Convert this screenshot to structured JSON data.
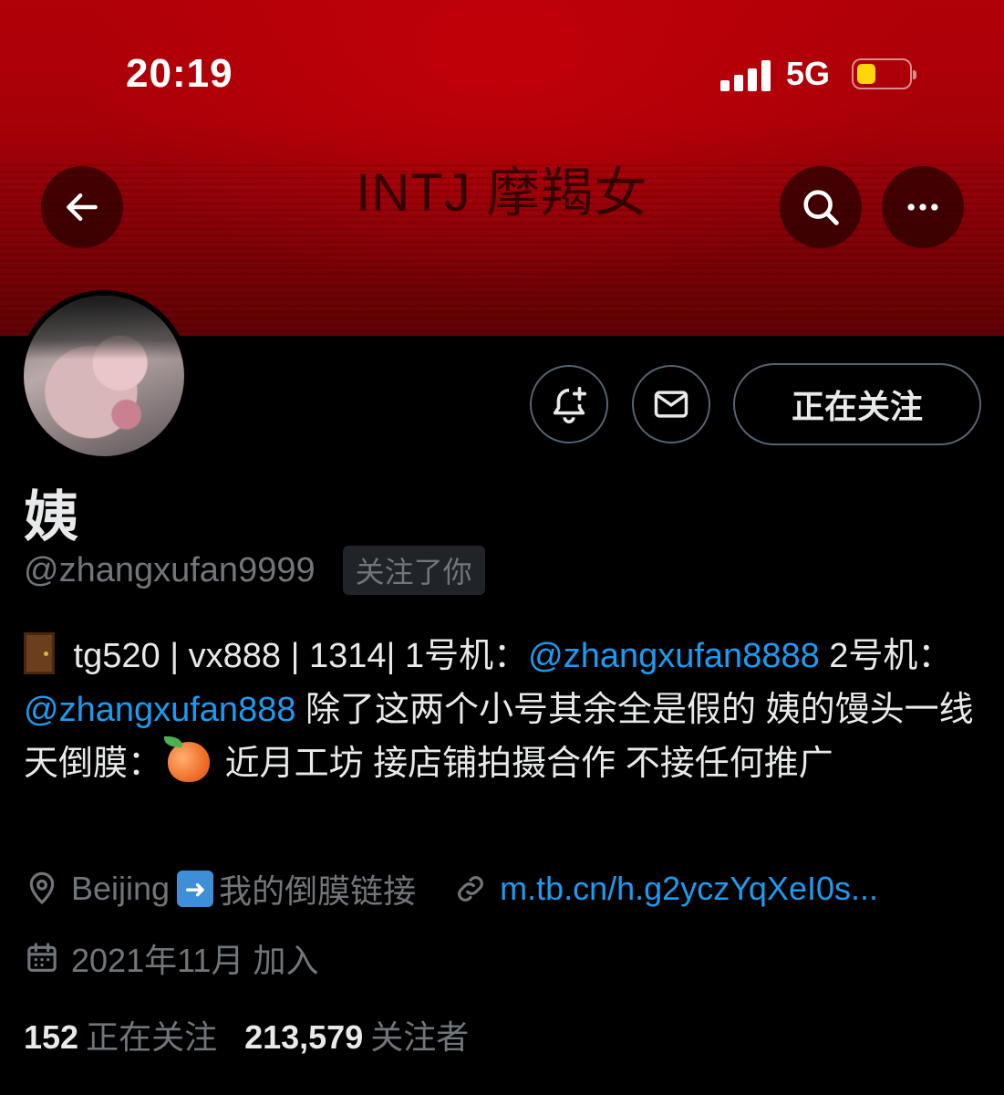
{
  "status_bar": {
    "time": "20:19",
    "network": "5G",
    "battery_fill_fraction": 0.35
  },
  "header": {
    "banner_title": "INTJ 摩羯女",
    "back_icon": "arrow-left-icon",
    "search_icon": "search-icon",
    "more_icon": "more-icon"
  },
  "actions": {
    "notify_icon": "bell-plus-icon",
    "message_icon": "mail-icon",
    "follow_label": "正在关注"
  },
  "profile": {
    "display_name": "姨",
    "handle": "@zhangxufan9999",
    "follows_you_badge": "关注了你",
    "bio": {
      "part1": " tg520 | vx888 | 1314| 1号机：",
      "mention1": "@zhangxufan8888",
      "part2": " 2号机：",
      "mention2": "@zhangxufan888",
      "part3": " 除了这两个小号其余全是假的 姨的馒头一线天倒膜：",
      "part4": " 近月工坊 接店铺拍摄合作 不接任何推广"
    },
    "location": "Beijing",
    "location_suffix": "我的倒膜链接",
    "website": "m.tb.cn/h.g2yczYqXeI0s...",
    "joined": "2021年11月 加入",
    "following_count": "152",
    "following_label": "正在关注",
    "followers_count": "213,579",
    "followers_label": "关注者"
  }
}
